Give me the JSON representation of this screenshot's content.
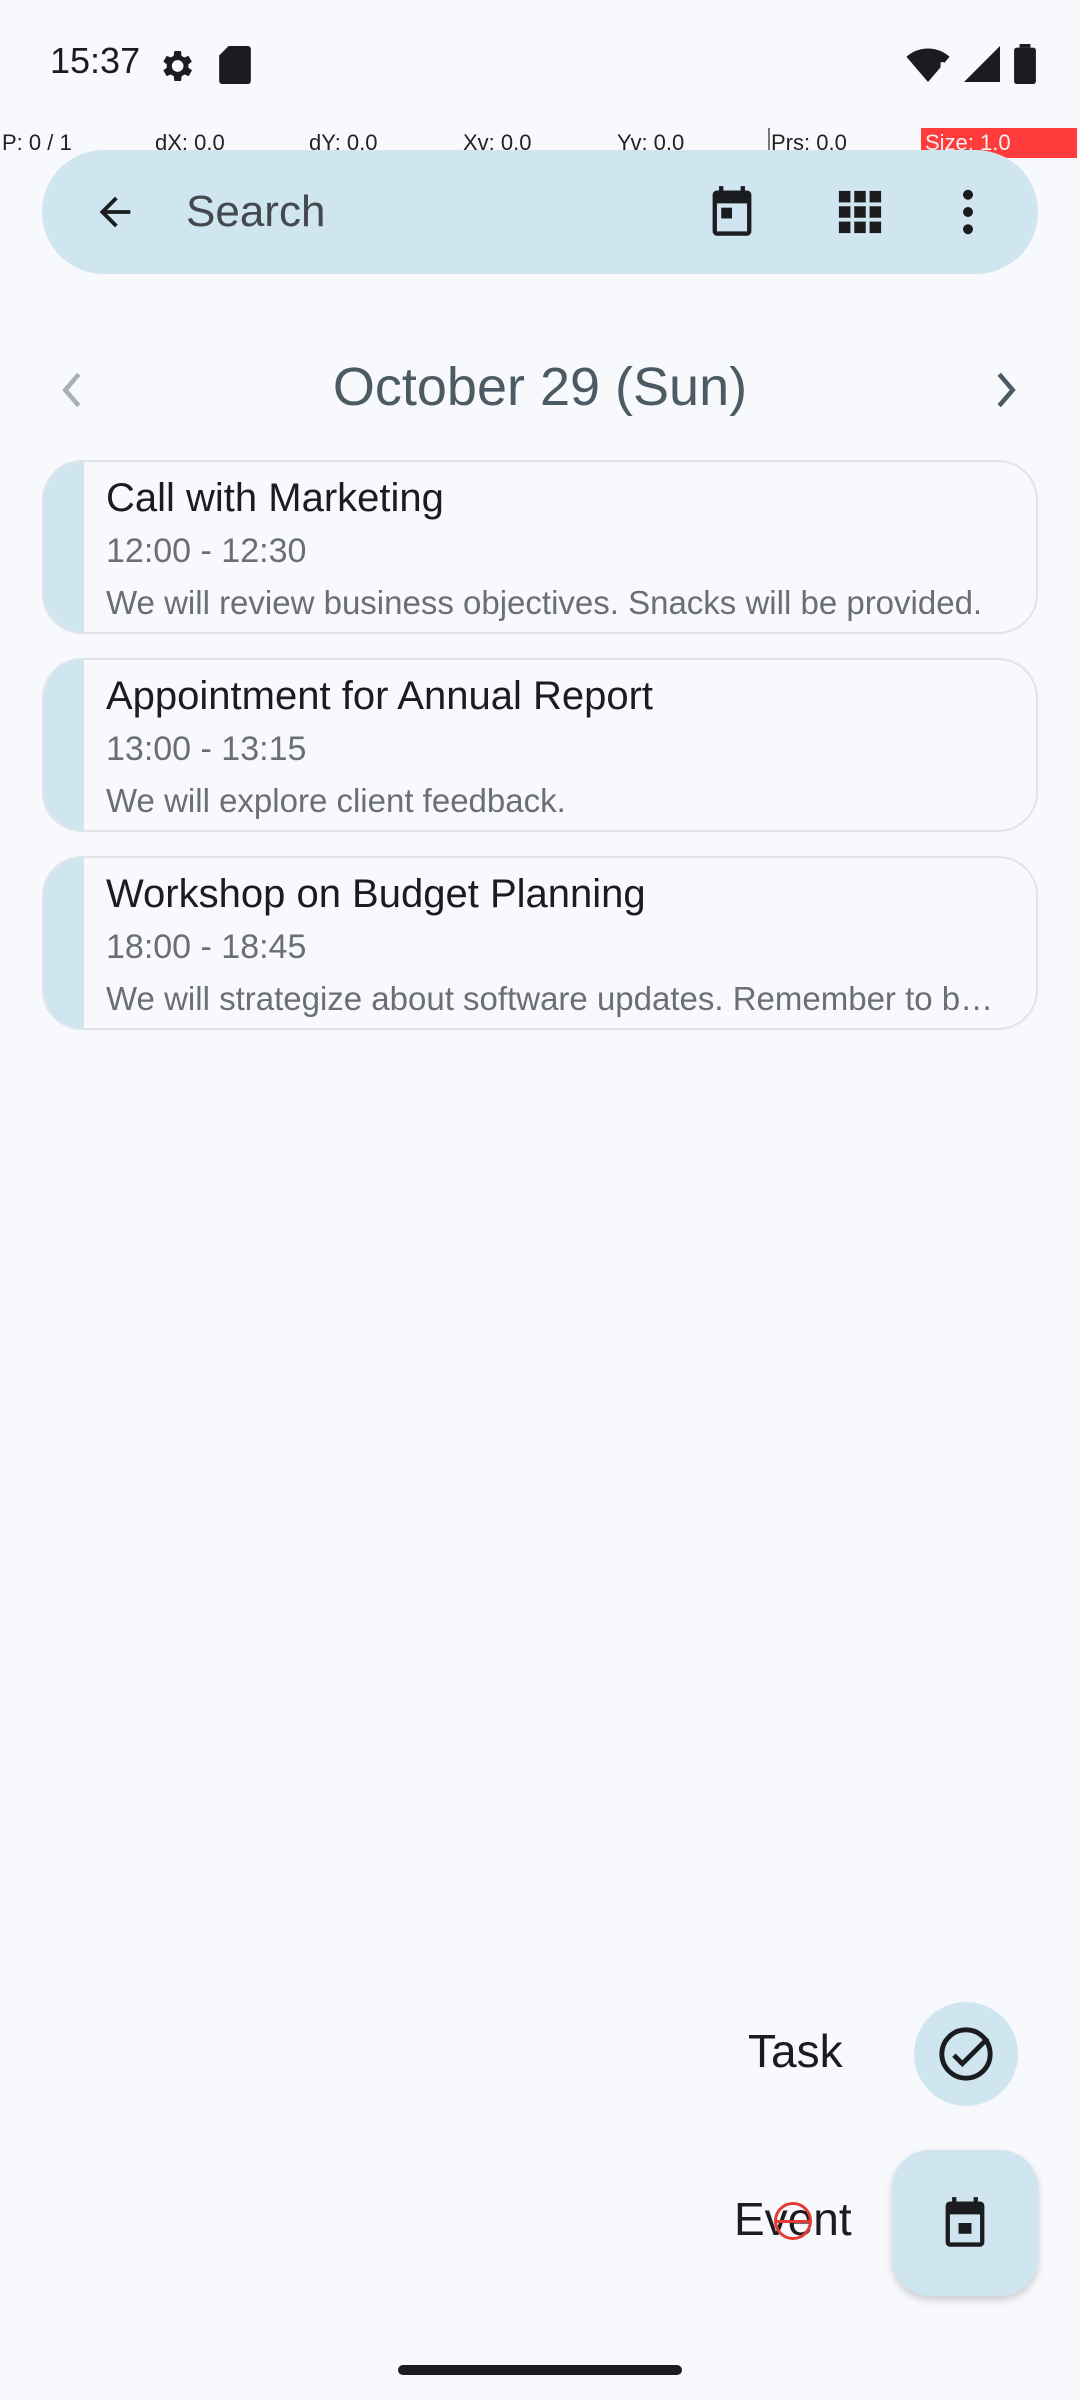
{
  "status_bar": {
    "time": "15:37",
    "icons": [
      "settings-icon",
      "sd-card-icon",
      "wifi-icon",
      "signal-icon",
      "battery-icon"
    ]
  },
  "debug": {
    "p": "P: 0 / 1",
    "dx": "dX: 0.0",
    "dy": "dY: 0.0",
    "xv": "Xv: 0.0",
    "yv": "Yv: 0.0",
    "prs": "Prs: 0.0",
    "size": "Size: 1.0"
  },
  "toolbar": {
    "search_placeholder": "Search",
    "icons": [
      "back-arrow-icon",
      "today-calendar-icon",
      "grid-view-icon",
      "more-vert-icon"
    ]
  },
  "date_header": {
    "title": "October 29 (Sun)"
  },
  "events": [
    {
      "title": "Call with Marketing",
      "time": "12:00 - 12:30",
      "description": "We will review business objectives. Snacks will be provided."
    },
    {
      "title": "Appointment for Annual Report",
      "time": "13:00 - 13:15",
      "description": "We will explore client feedback."
    },
    {
      "title": "Workshop on Budget Planning",
      "time": "18:00 - 18:45",
      "description": "We will strategize about software updates. Remember to bring your laptop."
    }
  ],
  "fab_menu": {
    "task_label": "Task",
    "event_label": "Event"
  },
  "colors": {
    "accent": "#cfe5ef",
    "background": "#f8f9fd",
    "debug_size_bg": "#ff3b3b"
  }
}
